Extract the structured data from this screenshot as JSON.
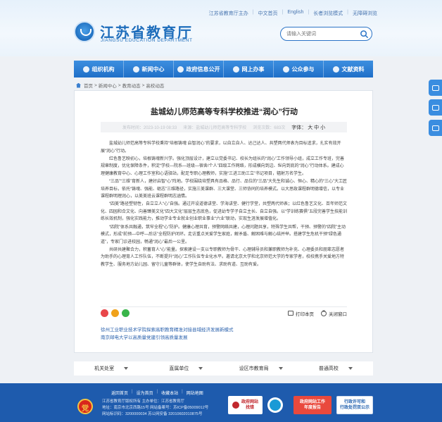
{
  "header": {
    "top_links": {
      "sponsor": "江苏省教育厅主办",
      "chinese": "中文首页",
      "english": "English",
      "elder_mode": "长者浏览模式",
      "accessibility": "无障碍浏览"
    },
    "logo_cn": "江苏省教育厅",
    "logo_en": "JIANGSU EDUCATION DEPARTMENT",
    "search_placeholder": "请输入关键词"
  },
  "nav": {
    "items": [
      "组织机构",
      "新闻中心",
      "政府信息公开",
      "网上办事",
      "公众参与",
      "文献资料"
    ]
  },
  "breadcrumb": {
    "home": "首页",
    "sep": ">",
    "news": "新闻中心",
    "news_section": "教育动态",
    "current": "高校动态"
  },
  "article": {
    "title": "盐城幼儿师范高等专科学校推进“润心”行动",
    "publish_time": "发布时间：2023-10-19 08:33",
    "source": "来源：盐城幼儿师范高等专科学校",
    "views": "浏览次数：683次",
    "font_size_label": "字体：",
    "font_big": "大",
    "font_mid": "中",
    "font_small": "小",
    "paragraphs": [
      "盐城幼儿师范高等专科学校秉持“培根铸魂 启智润心”的要求，以自立自人、达己达人、共塑两代师表为目标追求，扎实有效开展“润心”行动。",
      "红色鲁艺映初心，培根铸魂新兴学。强化顶层设计，建立以党委书记、校长为组长的“润心”工作领导小组，成立工作专班，完善规章制度，优化保障条件，积淀“学校—院系—班级—宿舍/个人”四级工作网络，形成横向到边、纵向到底的“润心”行动体系。建成心理健康教育中心、心理工作室和心语驿站，配足专职心理教师，实施“三进三助三立”书记项目，辐射万名学生。",
      "“三品”“三维”育新人，建好启智“心”阵地。学校围绕培塑具有品格、品行、品位的“三品”大先生和诚心、恒心、精心的“三心”大工匠培养目标，依托“铸魂、强能、砺志”三维路径，实施三美课群、三大课堂、三师协同的培养模式。以大思政课程群明德增信，以专业课程群明理润心，以美美班云课程群明志涵情。",
      "“四美”路径塑韧性，自立立人“心”自强。通过开设道德讲堂、学海讲堂、健行学堂，共塑两代师表；以红色鲁艺文化、百年师范文化、四园和合文化、向善臻美文化“四大文化”层层生态底色，促进幼专学子自立主长、自立自强。以“学训练赛俱”五段完善学生技能训练长效机制，强化实践能力，推动学业专业就业创业职业事业“六业”联动，实现生涯发展增值化。",
      "“四院”体系共融通，筑牢全程“心”防护。健康心理共育，预警网络共建，心理问题共享，特殊学生共帮，干预、预警的“四院”主动模式，形成“前预—中呼—后访”全程防护闭环。走访重点关爱学生家庭，解矛盾、解困难与解心结并举。搭建学生危机干预“绿色通道”，专家门诊进校园，畅通“润心”最后一公里。",
      "共研共建聚合力，积蓄育人“心”能量。探索建设一支以专职教师为骨干、心理辅导员和兼职教师为补充、心理委员和朋辈志愿者为助手的心理育人工作队伍，不断提升“润心”工作队伍专业化水平。邀请北京大学和北京师范大学的专家学者，校校携手关爱地方特教学生、服务地方幼儿园、留守儿童等群体，使学生自助有法、求助有道、互助有爱。"
    ],
    "print_label": "打印本页",
    "close_label": "关闭窗口",
    "related": [
      "徐州工业职业技术学院探索高职教育精准对接县域经济发展新模式",
      "南京邮电大学以高质量党建引领高质量发展"
    ]
  },
  "links_row": [
    "机关处室",
    "直属单位",
    "设区市教育局",
    "普通高校"
  ],
  "footer": {
    "links": [
      "返回首页",
      "设为首页",
      "收藏本站",
      "网站地图"
    ],
    "sponsor_line": "江苏省教育厅版权所有 主办单位：江苏省教育厅",
    "address_line": "地址：南京市北京西路15号 网站备案号：苏ICP备05009012号",
    "code_line": "网站标识码：3200000034 苏公网安备 32010602010875号",
    "party_glyph": "党",
    "gov_badge_line1": "政府网站",
    "gov_badge_line2": "找错",
    "annual_line1": "政府网站工作",
    "annual_line2": "年度报告",
    "license_line1": "行政许可和",
    "license_line2": "行政处罚双公示"
  },
  "colors": {
    "primary_blue": "#1f6fc8",
    "footer_blue": "#1e5bad",
    "link_blue": "#2b62ad"
  }
}
